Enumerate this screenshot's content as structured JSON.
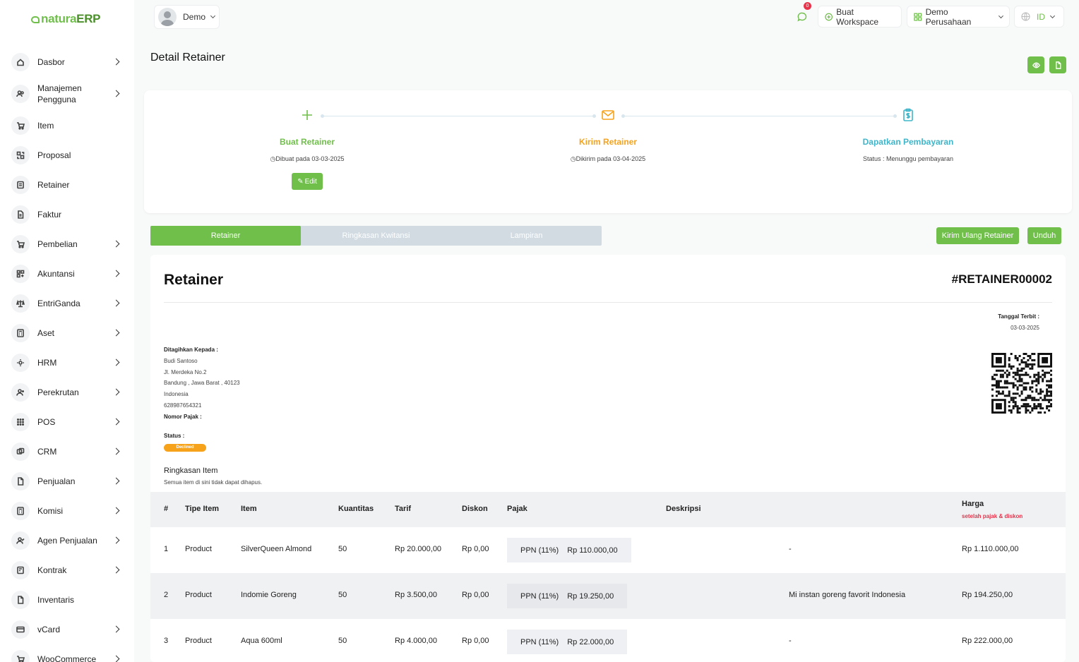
{
  "app": {
    "logo_prefix": "natura",
    "logo_suffix": "ERP"
  },
  "sidebar": {
    "items": [
      {
        "label": "Dasbor",
        "icon": "home-icon",
        "chevron": true
      },
      {
        "label": "Manajemen Pengguna",
        "icon": "users-icon",
        "chevron": true
      },
      {
        "label": "Item",
        "icon": "cart-icon",
        "chevron": false
      },
      {
        "label": "Proposal",
        "icon": "proposal-icon",
        "chevron": false
      },
      {
        "label": "Retainer",
        "icon": "retainer-icon",
        "chevron": false
      },
      {
        "label": "Faktur",
        "icon": "invoice-icon",
        "chevron": false
      },
      {
        "label": "Pembelian",
        "icon": "cart-icon",
        "chevron": true
      },
      {
        "label": "Akuntansi",
        "icon": "grid-icon",
        "chevron": true
      },
      {
        "label": "EntriGanda",
        "icon": "scale-icon",
        "chevron": true
      },
      {
        "label": "Aset",
        "icon": "calculator-icon",
        "chevron": true
      },
      {
        "label": "HRM",
        "icon": "hrm-icon",
        "chevron": true
      },
      {
        "label": "Perekrutan",
        "icon": "user-plus-icon",
        "chevron": true
      },
      {
        "label": "POS",
        "icon": "dots-grid-icon",
        "chevron": true
      },
      {
        "label": "CRM",
        "icon": "crm-icon",
        "chevron": true
      },
      {
        "label": "Penjualan",
        "icon": "file-icon",
        "chevron": true
      },
      {
        "label": "Komisi",
        "icon": "calculator-icon",
        "chevron": true
      },
      {
        "label": "Agen Penjualan",
        "icon": "user-check-icon",
        "chevron": true
      },
      {
        "label": "Kontrak",
        "icon": "contract-icon",
        "chevron": true
      },
      {
        "label": "Inventaris",
        "icon": "file-icon",
        "chevron": false
      },
      {
        "label": "vCard",
        "icon": "card-icon",
        "chevron": true
      },
      {
        "label": "WooCommerce",
        "icon": "cart-icon",
        "chevron": true
      }
    ]
  },
  "topbar": {
    "user": "Demo",
    "notif_count": "0",
    "create_workspace": "Buat Workspace",
    "company": "Demo Perusahaan",
    "language": "ID"
  },
  "page": {
    "title": "Detail Retainer"
  },
  "steps": [
    {
      "title": "Buat Retainer",
      "subtitle": "Dibuat pada 03-03-2025",
      "color": "#6fbf4a",
      "icon": "plus-icon"
    },
    {
      "title": "Kirim Retainer",
      "subtitle": "Dikirim pada 03-04-2025",
      "color": "#f7a21b",
      "icon": "mail-icon"
    },
    {
      "title": "Dapatkan Pembayaran",
      "subtitle": "Status : Menunggu pembayaran",
      "color": "#3fb5c9",
      "icon": "clipboard-dollar-icon"
    }
  ],
  "edit_label": "Edit",
  "tabs": [
    "Retainer",
    "Ringkasan Kwitansi",
    "Lampiran"
  ],
  "actions": {
    "resend": "Kirim Ulang Retainer",
    "download": "Unduh"
  },
  "doc": {
    "heading": "Retainer",
    "number": "#RETAINER00002",
    "issue_label": "Tanggal Terbit :",
    "issue_date": "03-03-2025",
    "billed_label": "Ditagihkan Kepada :",
    "billed_lines": [
      "Budi Santoso",
      "Jl. Merdeka No.2",
      "Bandung , Jawa Barat , 40123",
      "Indonesia",
      "628987654321"
    ],
    "tax_label": "Nomor Pajak :",
    "status_label": "Status :",
    "status": "Declined",
    "summary_title": "Ringkasan Item",
    "summary_note": "Semua item di sini tidak dapat dihapus."
  },
  "table": {
    "headers": [
      "#",
      "Tipe Item",
      "Item",
      "Kuantitas",
      "Tarif",
      "Diskon",
      "Pajak",
      "Deskripsi",
      "Harga"
    ],
    "price_note": "setelah pajak & diskon",
    "rows": [
      {
        "no": "1",
        "type": "Product",
        "item": "SilverQueen Almond",
        "qty": "50",
        "rate": "Rp 20.000,00",
        "discount": "Rp 0,00",
        "tax_name": "PPN (11%)",
        "tax_amount": "Rp 110.000,00",
        "description": "-",
        "price": "Rp 1.110.000,00"
      },
      {
        "no": "2",
        "type": "Product",
        "item": "Indomie Goreng",
        "qty": "50",
        "rate": "Rp 3.500,00",
        "discount": "Rp 0,00",
        "tax_name": "PPN (11%)",
        "tax_amount": "Rp 19.250,00",
        "description": "Mi instan goreng favorit Indonesia",
        "price": "Rp 194.250,00"
      },
      {
        "no": "3",
        "type": "Product",
        "item": "Aqua 600ml",
        "qty": "50",
        "rate": "Rp 4.000,00",
        "discount": "Rp 0,00",
        "tax_name": "PPN (11%)",
        "tax_amount": "Rp 22.000,00",
        "description": "-",
        "price": "Rp 222.000,00"
      }
    ]
  }
}
